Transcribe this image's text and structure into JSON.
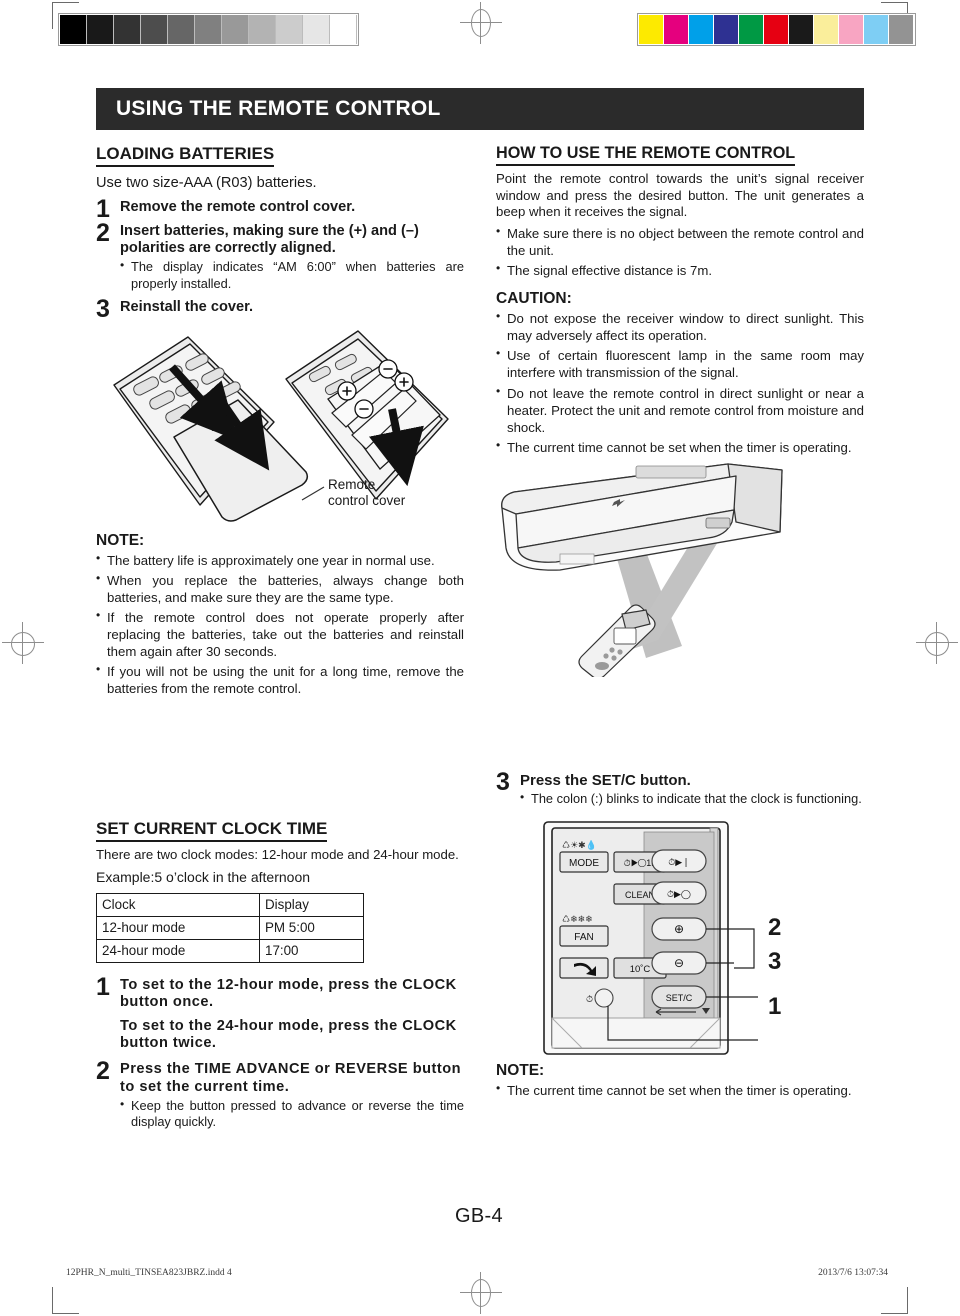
{
  "document": {
    "page_label": "GB-4",
    "footer_left": "12PHR_N_multi_TINSEA823JBRZ.indd   4",
    "footer_right": "2013/7/6   13:07:34"
  },
  "header": {
    "title": "USING THE REMOTE CONTROL"
  },
  "print_marks": {
    "gray_bar": [
      "#000000",
      "#191919",
      "#333333",
      "#4d4d4d",
      "#666666",
      "#808080",
      "#999999",
      "#b3b3b3",
      "#cccccc",
      "#e6e6e6",
      "#ffffff"
    ],
    "color_bar": [
      "#fdea00",
      "#e5007e",
      "#00a0e9",
      "#2e3192",
      "#009944",
      "#e60012",
      "#1a1a1a",
      "#faee9b",
      "#f8a5c2",
      "#7ecef4",
      "#939393"
    ]
  },
  "left_column": {
    "loading_batteries": {
      "heading": "LOADING BATTERIES",
      "lead": "Use two size-AAA (R03) batteries.",
      "steps": [
        {
          "num": "1",
          "text": "Remove the remote control cover.",
          "bullets": []
        },
        {
          "num": "2",
          "text": "Insert batteries, making sure the (+) and (–) polarities are correctly aligned.",
          "bullets": [
            "The display indicates “AM 6:00” when batteries are properly installed."
          ]
        },
        {
          "num": "3",
          "text": "Reinstall  the cover.",
          "bullets": []
        }
      ]
    },
    "figure_caption": "Remote\ncontrol cover",
    "figure_caption_line1": "Remote",
    "figure_caption_line2": "control cover",
    "note": {
      "heading": "NOTE:",
      "bullets": [
        "The battery life is approximately one year in normal use.",
        "When you replace the batteries, always change both batteries, and make sure they are the same type.",
        "If the remote control does not operate properly after replacing the batteries, take out the batteries and reinstall them again after  30 seconds.",
        "If you will not be using the unit for a long time, remove the batteries from the remote control."
      ]
    },
    "set_clock": {
      "heading": "SET CURRENT CLOCK TIME",
      "intro": "There are two clock modes: 12-hour mode and 24-hour mode.",
      "example": "Example:5 o’clock in the afternoon",
      "table": {
        "headers": [
          "Clock",
          "Display"
        ],
        "rows": [
          [
            "12-hour mode",
            "PM   5:00"
          ],
          [
            "24-hour mode",
            "17:00"
          ]
        ]
      },
      "steps": [
        {
          "num": "1",
          "text_line1": "To set to the 12-hour mode, press the CLOCK button once.",
          "text_line2": "To set to the 24-hour mode, press the CLOCK button twice.",
          "bullets": []
        },
        {
          "num": "2",
          "text_line1": "Press the TIME ADVANCE or REVERSE button to set the current time.",
          "bullets": [
            "Keep the button pressed to advance or reverse the time display quickly."
          ]
        }
      ]
    }
  },
  "right_column": {
    "how_to_use": {
      "heading": "HOW TO USE THE REMOTE CONTROL",
      "body": "Point the remote control towards the unit’s signal receiver window and press the desired button. The unit generates a beep when it receives the signal.",
      "bullets": [
        "Make sure  there is no object between the remote control and the unit.",
        "The signal effective distance is 7m."
      ]
    },
    "caution": {
      "heading": "CAUTION:",
      "bullets": [
        "Do not expose the receiver window to direct sunlight. This may adversely affect its operation.",
        "Use of certain fluorescent lamp in the same room may interfere with transmission of the signal.",
        "Do not leave the remote control in direct sunlight or near a heater. Protect the unit and remote control from moisture and shock.",
        "The current time cannot be set when the timer is operating."
      ]
    },
    "set_clock_step3": {
      "num": "3",
      "text": "Press the SET/C button.",
      "bullets": [
        "The colon (:) blinks to indicate that the clock is functioning."
      ]
    },
    "remote_panel": {
      "buttons": {
        "mode": "MODE",
        "timer_1h": "⏱▸○1h",
        "clean": "CLEAN",
        "fan": "FAN",
        "ten_degree": "10˚C",
        "set_c": "SET/C"
      },
      "callouts": [
        "2",
        "3",
        "1"
      ]
    },
    "note": {
      "heading": "NOTE:",
      "bullets": [
        "The current time cannot be set when the timer is operating."
      ]
    }
  }
}
